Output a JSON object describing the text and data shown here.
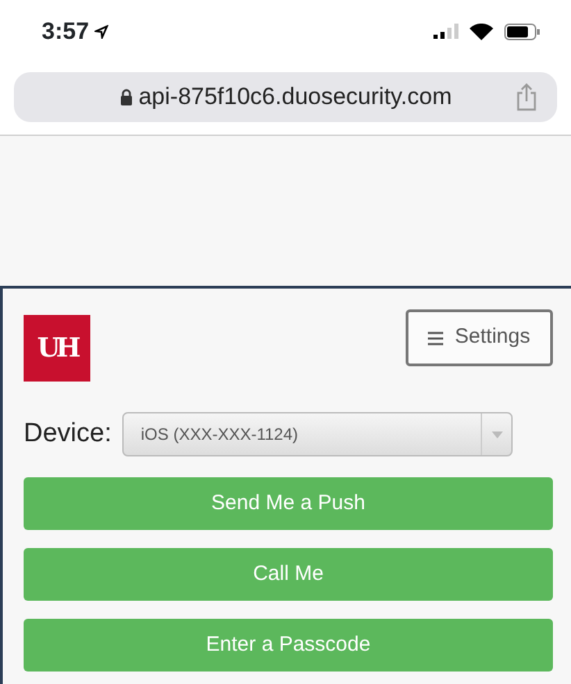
{
  "status_bar": {
    "time": "3:57"
  },
  "address_bar": {
    "url": "api-875f10c6.duosecurity.com"
  },
  "logo": {
    "text": "UH"
  },
  "settings_button": {
    "label": "Settings"
  },
  "device": {
    "label": "Device:",
    "value": "iOS (XXX-XXX-1124)"
  },
  "buttons": [
    "Send Me a Push",
    "Call Me",
    "Enter a Passcode"
  ]
}
